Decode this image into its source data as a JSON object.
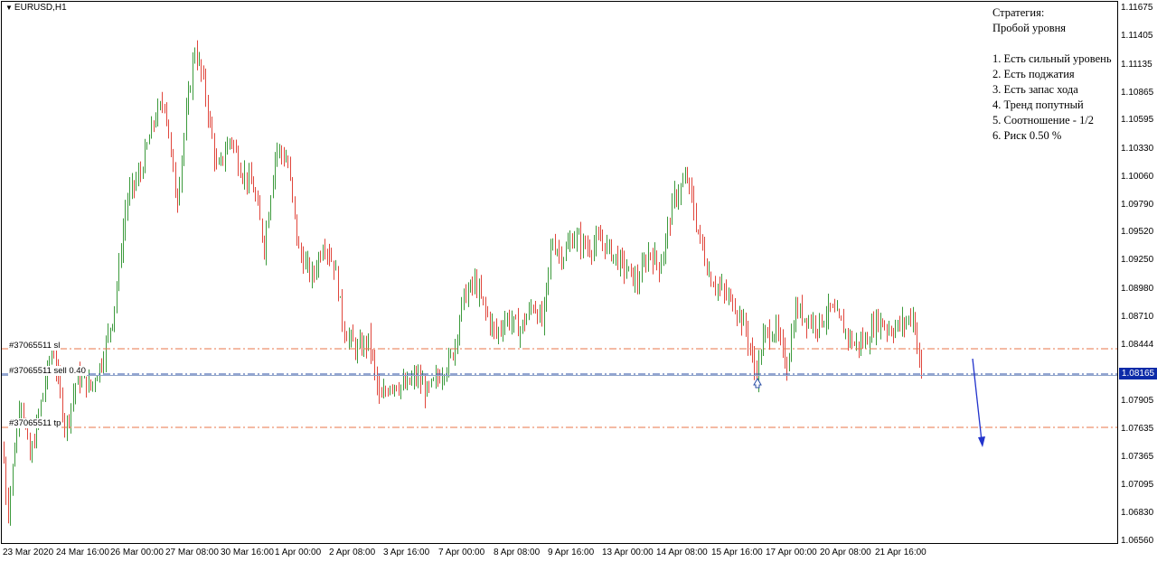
{
  "chart_title": "EURUSD,H1",
  "current_price": "1.08165",
  "price_axis": [
    "1.11675",
    "1.11405",
    "1.11135",
    "1.10865",
    "1.10595",
    "1.10330",
    "1.10060",
    "1.09790",
    "1.09520",
    "1.09250",
    "1.08980",
    "1.08710",
    "1.08444",
    "1.08174",
    "1.07905",
    "1.07635",
    "1.07365",
    "1.07095",
    "1.06830",
    "1.06560"
  ],
  "time_axis": [
    "23 Mar 2020",
    "24 Mar 16:00",
    "26 Mar 00:00",
    "27 Mar 08:00",
    "30 Mar 16:00",
    "1 Apr 00:00",
    "2 Apr 08:00",
    "3 Apr 16:00",
    "7 Apr 00:00",
    "8 Apr 08:00",
    "9 Apr 16:00",
    "13 Apr 00:00",
    "14 Apr 08:00",
    "15 Apr 16:00",
    "17 Apr 00:00",
    "20 Apr 08:00",
    "21 Apr 16:00"
  ],
  "orders": {
    "sl_label": "#37065511 sl",
    "entry_label": "#37065511 sell 0.40",
    "tp_label": "#37065511 tp"
  },
  "strategy": {
    "heading1": "Стратегия:",
    "heading2": "Пробой уровня",
    "items": [
      "1. Есть сильный уровень",
      "2. Есть поджатия",
      "3. Есть запас хода",
      "4. Тренд попутный",
      "5. Соотношение - 1/2",
      "6. Риск 0.50 %"
    ]
  },
  "colors": {
    "bull": "#3c9a3c",
    "bear": "#e0463c",
    "order_line": "#e8744a",
    "entry_line": "#2a4ea6",
    "arrow": "#2233cc"
  },
  "chart_data": {
    "type": "candlestick",
    "symbol": "EURUSD",
    "timeframe": "H1",
    "ylim": [
      1.0656,
      1.11675
    ],
    "path": [
      [
        0,
        1.0785
      ],
      [
        8,
        1.0682
      ],
      [
        22,
        1.0798
      ],
      [
        33,
        1.0735
      ],
      [
        45,
        1.079
      ],
      [
        58,
        1.0845
      ],
      [
        72,
        1.0765
      ],
      [
        85,
        1.0815
      ],
      [
        100,
        1.0805
      ],
      [
        112,
        1.083
      ],
      [
        125,
        1.0875
      ],
      [
        140,
        1.0985
      ],
      [
        155,
        1.101
      ],
      [
        170,
        1.106
      ],
      [
        182,
        1.108
      ],
      [
        195,
        1.098
      ],
      [
        205,
        1.106
      ],
      [
        215,
        1.113
      ],
      [
        225,
        1.1095
      ],
      [
        240,
        1.101
      ],
      [
        255,
        1.1045
      ],
      [
        265,
        1.1015
      ],
      [
        280,
        1.0995
      ],
      [
        292,
        1.094
      ],
      [
        305,
        1.1035
      ],
      [
        318,
        1.102
      ],
      [
        330,
        1.0935
      ],
      [
        345,
        1.091
      ],
      [
        358,
        1.0945
      ],
      [
        370,
        1.092
      ],
      [
        380,
        1.086
      ],
      [
        395,
        1.084
      ],
      [
        408,
        1.085
      ],
      [
        420,
        1.079
      ],
      [
        432,
        1.081
      ],
      [
        448,
        1.0805
      ],
      [
        460,
        1.0815
      ],
      [
        472,
        1.08
      ],
      [
        485,
        1.0815
      ],
      [
        500,
        1.0835
      ],
      [
        512,
        1.089
      ],
      [
        525,
        1.0905
      ],
      [
        538,
        1.0875
      ],
      [
        548,
        1.0855
      ],
      [
        560,
        1.0872
      ],
      [
        575,
        1.086
      ],
      [
        590,
        1.0885
      ],
      [
        600,
        1.0865
      ],
      [
        610,
        1.0945
      ],
      [
        622,
        1.093
      ],
      [
        635,
        1.095
      ],
      [
        650,
        1.0938
      ],
      [
        665,
        1.0945
      ],
      [
        680,
        1.093
      ],
      [
        695,
        1.0915
      ],
      [
        705,
        1.0905
      ],
      [
        718,
        1.0935
      ],
      [
        730,
        1.092
      ],
      [
        745,
        1.0985
      ],
      [
        760,
        1.1005
      ],
      [
        770,
        1.096
      ],
      [
        785,
        1.091
      ],
      [
        800,
        1.0895
      ],
      [
        812,
        1.0885
      ],
      [
        825,
        1.086
      ],
      [
        836,
        1.0815
      ],
      [
        845,
        1.0855
      ],
      [
        858,
        1.086
      ],
      [
        870,
        1.0825
      ],
      [
        880,
        1.088
      ],
      [
        893,
        1.087
      ],
      [
        905,
        1.0865
      ],
      [
        918,
        1.088
      ],
      [
        930,
        1.0865
      ],
      [
        945,
        1.0845
      ],
      [
        958,
        1.085
      ],
      [
        970,
        1.087
      ],
      [
        985,
        1.086
      ],
      [
        998,
        1.0865
      ],
      [
        1010,
        1.0875
      ],
      [
        1020,
        1.081
      ]
    ],
    "levels": {
      "stop_loss": 1.0842,
      "entry": 1.08174,
      "take_profit": 1.0766,
      "current": 1.08165
    }
  }
}
